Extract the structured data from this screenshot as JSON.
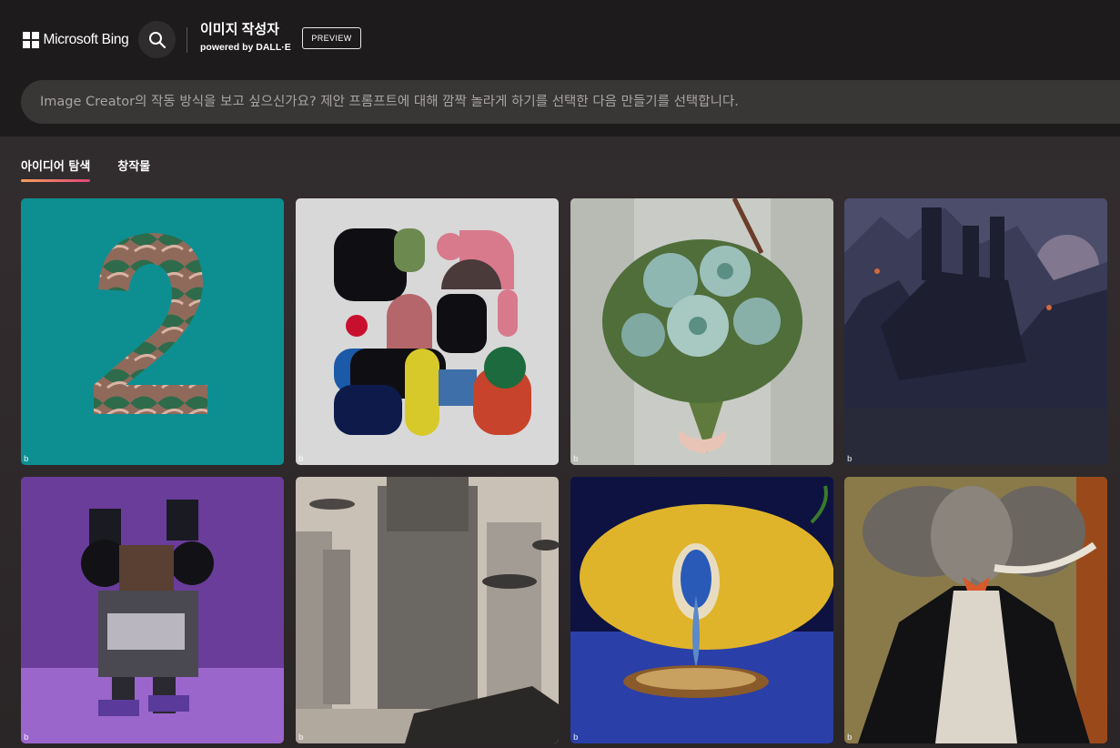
{
  "header": {
    "brand": "Microsoft Bing",
    "logo_icon": "microsoft-logo-icon",
    "search_icon": "search-icon",
    "title": "이미지 작성자",
    "subtitle": "powered by DALL·E",
    "badge": "PREVIEW"
  },
  "prompt": {
    "placeholder": "Image Creator의 작동 방식을 보고 싶으신가요? 제안 프롬프트에 대해 깜짝 놀라게 하기를 선택한 다음 만들기를 선택합니다.",
    "value": ""
  },
  "tabs": [
    {
      "label": "아이디어 탐색",
      "active": true
    },
    {
      "label": "창작물",
      "active": false
    }
  ],
  "gallery": {
    "watermark": "b",
    "items": [
      {
        "subject": "number-two-teal"
      },
      {
        "subject": "abstract-shapes"
      },
      {
        "subject": "succulent-bouquet"
      },
      {
        "subject": "dark-castle-mountains"
      },
      {
        "subject": "purple-robot"
      },
      {
        "subject": "futuristic-city"
      },
      {
        "subject": "lemon-eye-painting"
      },
      {
        "subject": "elephant-in-suit"
      }
    ]
  },
  "colors": {
    "header_bg": "#1d1b1b",
    "prompt_bg": "#393636",
    "tab_underline_start": "#f5a05a",
    "tab_underline_end": "#e0457c"
  }
}
